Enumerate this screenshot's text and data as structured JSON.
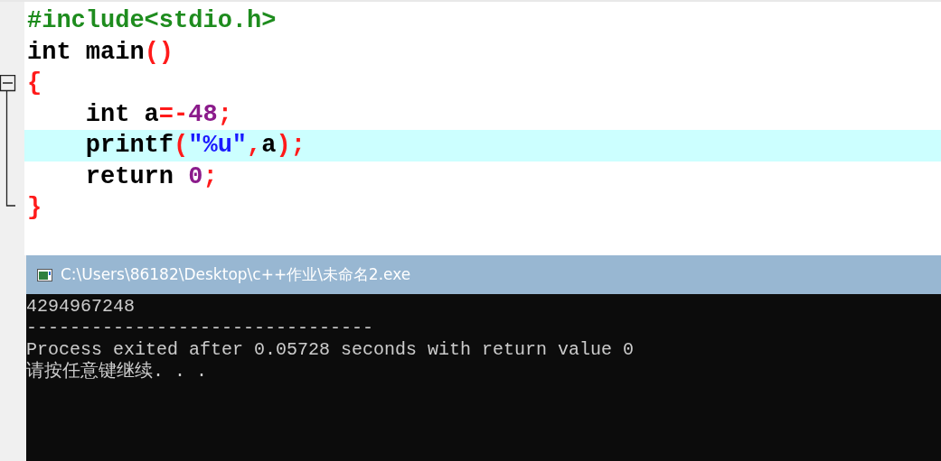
{
  "editor": {
    "lines": [
      {
        "highlighted": false,
        "tokens": [
          {
            "kind": "preprocessor",
            "text": "#include<stdio.h>"
          }
        ]
      },
      {
        "highlighted": false,
        "tokens": [
          {
            "kind": "plain",
            "text": "int main"
          },
          {
            "kind": "punct",
            "text": "()"
          }
        ]
      },
      {
        "highlighted": false,
        "tokens": [
          {
            "kind": "punct",
            "text": "{"
          }
        ]
      },
      {
        "highlighted": false,
        "tokens": [
          {
            "kind": "plain",
            "text": "    int a"
          },
          {
            "kind": "punct",
            "text": "=-"
          },
          {
            "kind": "number",
            "text": "48"
          },
          {
            "kind": "punct",
            "text": ";"
          }
        ]
      },
      {
        "highlighted": true,
        "tokens": [
          {
            "kind": "plain",
            "text": "    printf"
          },
          {
            "kind": "punct",
            "text": "("
          },
          {
            "kind": "string",
            "text": "\"%u\""
          },
          {
            "kind": "punct",
            "text": ","
          },
          {
            "kind": "plain",
            "text": "a"
          },
          {
            "kind": "punct",
            "text": ");"
          }
        ]
      },
      {
        "highlighted": false,
        "tokens": [
          {
            "kind": "plain",
            "text": "    return "
          },
          {
            "kind": "number",
            "text": "0"
          },
          {
            "kind": "punct",
            "text": ";"
          }
        ]
      },
      {
        "highlighted": false,
        "tokens": [
          {
            "kind": "punct",
            "text": "}"
          }
        ]
      }
    ]
  },
  "console": {
    "title": "C:\\Users\\86182\\Desktop\\c++作业\\未命名2.exe",
    "lines": [
      "4294967248",
      "--------------------------------",
      "Process exited after 0.05728 seconds with return value 0",
      "请按任意键继续. . ."
    ]
  }
}
